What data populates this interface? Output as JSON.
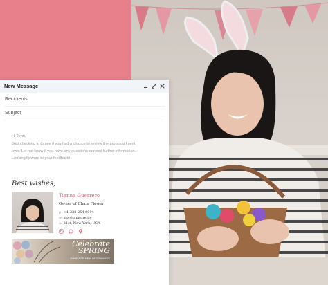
{
  "compose": {
    "title": "New Message",
    "recipients_placeholder": "Recipients",
    "subject_placeholder": "Subject",
    "body": {
      "greeting": "Hi John,",
      "line1": "Just checking in to see if you had a chance to review the proposal I sent",
      "line2": "over. Let me know if you have any questions or need further information.",
      "line3": "Looking forward to your feedback!"
    }
  },
  "signature": {
    "closing": "Best wishes,",
    "name": "Tianna Guerrero",
    "role": "Owner of Chain Flower",
    "phone_label": "p:",
    "phone": "+1 238 254 0094",
    "web_label": "w:",
    "web": "mysignature.io",
    "address_label": "a:",
    "address": "21st, New York, USA",
    "banner_title_1": "Celebrate",
    "banner_title_2": "SPRING",
    "banner_sub": "EMBRACE NEW BEGINNINGS"
  },
  "colors": {
    "accent_pink": "#e8808c",
    "name_color": "#d46a7c"
  },
  "icons": [
    "minimize-icon",
    "expand-icon",
    "close-icon",
    "instagram-icon",
    "whatsapp-icon",
    "location-icon"
  ]
}
